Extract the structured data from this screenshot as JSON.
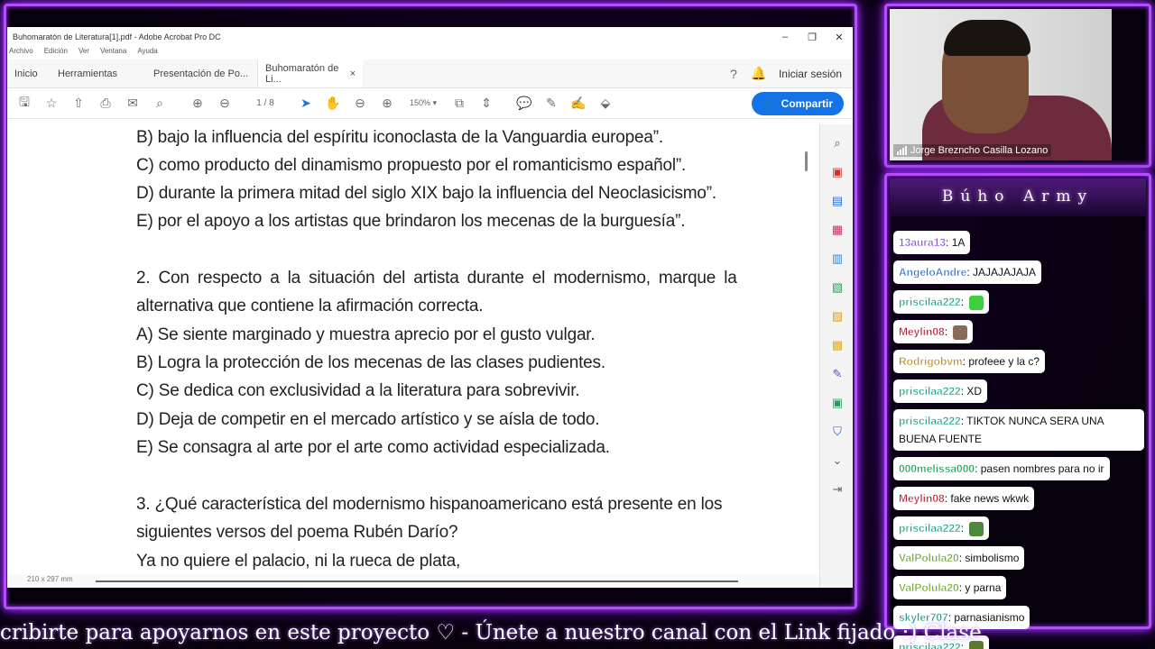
{
  "acrobat": {
    "title": "Buhomaratón de Literatura[1].pdf - Adobe Acrobat Pro DC",
    "window_controls": [
      "–",
      "❐",
      "✕"
    ],
    "menu": [
      "Archivo",
      "Edición",
      "Ver",
      "Ventana",
      "Ayuda"
    ],
    "tabs": {
      "home": "Inicio",
      "tools": "Herramientas",
      "doc1": "Presentación de Po...",
      "doc2": "Buhomaratón de Li...",
      "close": "×"
    },
    "signin": "Iniciar sesión",
    "page_current": "1",
    "page_total": "/ 8",
    "zoom": "150%",
    "share": "Compartir",
    "status_size": "210 x 297 mm"
  },
  "document": {
    "lines": [
      "B) bajo la influencia del espíritu iconoclasta de la Vanguardia europea”.",
      "C) como producto del dinamismo propuesto por el romanticismo español”.",
      "D) durante la primera mitad del siglo XIX bajo la influencia del Neoclasicismo”.",
      "E) por el apoyo a los artistas que brindaron los mecenas de la burguesía”.",
      "2. Con respecto a la situación del artista durante el modernismo, marque la",
      "alternativa que contiene la afirmación correcta.",
      "A) Se siente marginado y muestra aprecio por el gusto vulgar.",
      "B) Logra la protección de los mecenas de las clases pudientes.",
      "C) Se dedica con exclusividad a la literatura para sobrevivir.",
      "D) Deja de competir en el mercado artístico y se aísla de todo.",
      "E) Se consagra al arte por el arte como actividad especializada.",
      "3. ¿Qué característica del modernismo hispanoamericano está presente en los",
      "siguientes versos del poema Rubén Darío?",
      "Ya no quiere el palacio, ni la rueca de plata,"
    ]
  },
  "cam": {
    "name": "Jorge Breznchо Casilla Lozano"
  },
  "chat": {
    "title": "Búho Army",
    "messages": [
      {
        "user": "13aura13",
        "color": "#8e4fd8",
        "text": ": 1A",
        "emoji": null
      },
      {
        "user": "AngeloAndre",
        "color": "#2e6fd6",
        "text": ": JAJAJAJAJA",
        "emoji": null
      },
      {
        "user": "priscilaa222",
        "color": "#1aa58a",
        "text": ":",
        "emoji": "#3ecf3e"
      },
      {
        "user": "Meylin08",
        "color": "#c0182f",
        "text": ":",
        "emoji": "#8a6a5a"
      },
      {
        "user": "Rodrigobvm",
        "color": "#c48a1f",
        "text": ": profeee y la c?",
        "emoji": null
      },
      {
        "user": "priscilaa222",
        "color": "#1aa58a",
        "text": ": XD",
        "emoji": null
      },
      {
        "user": "priscilaa222",
        "color": "#1aa58a",
        "text": ": TIKTOK NUNCA SERA UNA BUENA FUENTE",
        "emoji": null
      },
      {
        "user": "000melissa000",
        "color": "#1a9a50",
        "text": ": pasen nombres para no ir",
        "emoji": null
      },
      {
        "user": "Meylin08",
        "color": "#c0182f",
        "text": ": fake news wkwk",
        "emoji": null
      },
      {
        "user": "priscilaa222",
        "color": "#1aa58a",
        "text": ":",
        "emoji": "#4a8a3a"
      },
      {
        "user": "ValPolula20",
        "color": "#6aab2a",
        "text": ": simbolismo",
        "emoji": null
      },
      {
        "user": "ValPolula20",
        "color": "#6aab2a",
        "text": ": y parna",
        "emoji": null
      },
      {
        "user": "skyler707",
        "color": "#1f9a8a",
        "text": ": parnasianismo",
        "emoji": null
      },
      {
        "user": "priscilaa222",
        "color": "#1aa58a",
        "text": ":",
        "emoji": "#5a7a2a"
      }
    ]
  },
  "ticker": "cribirte para apoyarnos en este proyecto  ♡   -   Únete a nuestro canal con el Link fijado :)  Clase"
}
